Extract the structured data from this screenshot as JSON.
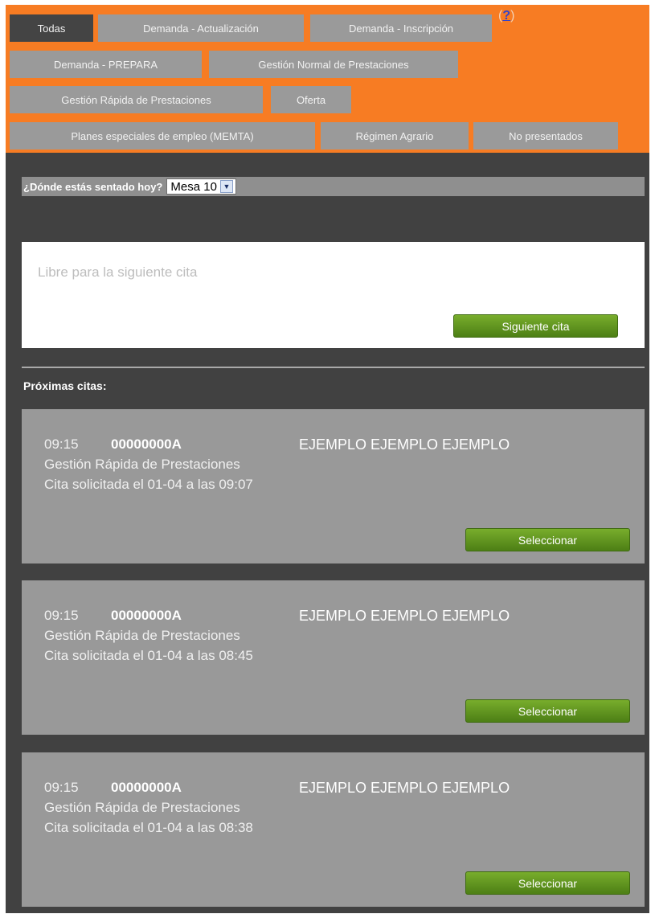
{
  "tabs": [
    {
      "label": "Todas",
      "active": true
    },
    {
      "label": "Demanda - Actualización"
    },
    {
      "label": "Demanda - Inscripción"
    },
    {
      "label": "Demanda - PREPARA"
    },
    {
      "label": "Gestión Normal de Prestaciones"
    },
    {
      "label": "Gestión Rápida de Prestaciones"
    },
    {
      "label": "Oferta"
    },
    {
      "label": "Planes especiales de empleo (MEMTA)"
    },
    {
      "label": "Régimen Agrario"
    },
    {
      "label": "No presentados"
    }
  ],
  "help": {
    "open": "(",
    "mark": "?",
    "close": ")"
  },
  "seat": {
    "label": "¿Dónde estás sentado hoy?",
    "selected": "Mesa 10"
  },
  "free_panel": {
    "text": "Libre para la siguiente cita",
    "button": "Siguiente cita"
  },
  "upcoming": {
    "label": "Próximas citas:",
    "items": [
      {
        "time": "09:15",
        "id": "00000000A",
        "name": "EJEMPLO EJEMPLO EJEMPLO",
        "service": "Gestión Rápida de Prestaciones",
        "requested": "Cita solicitada el 01-04 a las 09:07",
        "button": "Seleccionar"
      },
      {
        "time": "09:15",
        "id": "00000000A",
        "name": "EJEMPLO EJEMPLO EJEMPLO",
        "service": "Gestión Rápida de Prestaciones",
        "requested": "Cita solicitada el 01-04 a las 08:45",
        "button": "Seleccionar"
      },
      {
        "time": "09:15",
        "id": "00000000A",
        "name": "EJEMPLO EJEMPLO EJEMPLO",
        "service": "Gestión Rápida de Prestaciones",
        "requested": "Cita solicitada el 01-04 a las 08:38",
        "button": "Seleccionar"
      }
    ]
  },
  "colors": {
    "accent": "#f77c23",
    "background": "#414141",
    "tab": "#9a9a9a",
    "tab_active": "#444444",
    "button": "#5a8c1e",
    "card": "#999999"
  }
}
